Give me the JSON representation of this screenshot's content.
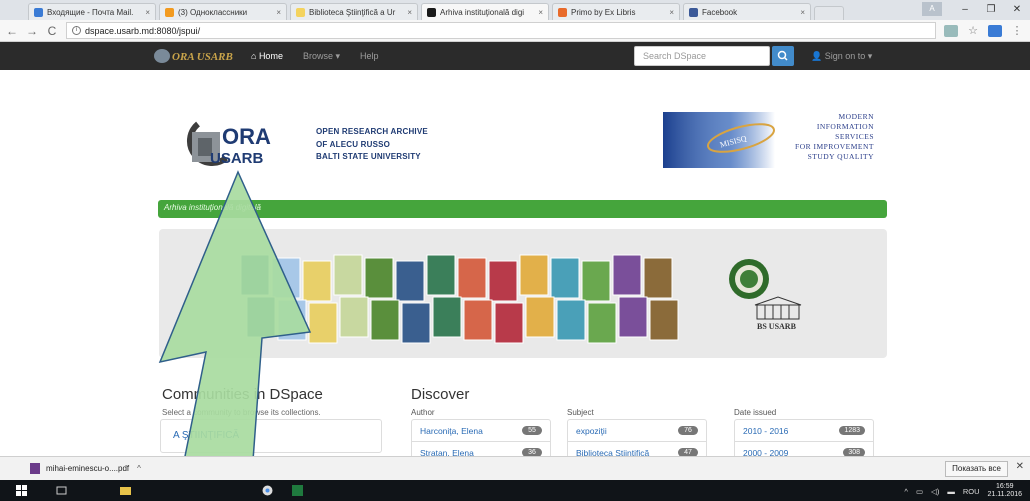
{
  "browser": {
    "tabs": [
      {
        "title": "Входящие - Почта Mail.",
        "color": "#3a7bd5",
        "active": false
      },
      {
        "title": "(3) Одноклассники",
        "color": "#f29a1f",
        "active": false
      },
      {
        "title": "Biblioteca Ştiinţifică a Ur",
        "color": "#f4d35e",
        "active": false
      },
      {
        "title": "Arhiva instituţională digi",
        "color": "#1a1a1a",
        "active": true
      },
      {
        "title": "Primo by Ex Libris",
        "color": "#e86a2a",
        "active": false
      },
      {
        "title": "Facebook",
        "color": "#3b5998",
        "active": false
      }
    ],
    "tab_close": "×",
    "url": "dspace.usarb.md:8080/jspui/",
    "window_controls": {
      "user": "A",
      "minimize": "–",
      "maximize": "❐",
      "close": "✕"
    },
    "nav": {
      "back": "←",
      "forward": "→",
      "reload": "C",
      "info": "i"
    }
  },
  "navbar": {
    "brand": "ORA USARB",
    "home": "Home",
    "browse": "Browse ▾",
    "help": "Help",
    "search_placeholder": "Search DSpace",
    "sign_on": "Sign on to ▾"
  },
  "header": {
    "logo_lines": [
      "OPEN RESEARCH ARCHIVE",
      "OF ALECU RUSSO",
      "BALTI STATE UNIVERSITY"
    ],
    "logo_word_top": "ORA",
    "logo_word_bottom": "USARB",
    "mis_lines": [
      "MODERN",
      "INFORMATION",
      "SERVICES",
      "FOR IMPROVEMENT",
      "STUDY QUALITY"
    ],
    "mis_badge": "MISISQ"
  },
  "breadcrumb": "Arhiva instituţională digitală",
  "banner": {
    "right_label": "BS USARB"
  },
  "communities": {
    "title": "Communities in DSpace",
    "subtitle": "Select a community to browse its collections.",
    "first_item": "A ŞTIINŢIFICĂ"
  },
  "discover": {
    "title": "Discover",
    "facets": [
      {
        "heading": "Author",
        "rows": [
          {
            "label": "Harconiţa, Elena",
            "count": "55"
          },
          {
            "label": "Stratan, Elena",
            "count": "36"
          }
        ]
      },
      {
        "heading": "Subject",
        "rows": [
          {
            "label": "expoziţii",
            "count": "76"
          },
          {
            "label": "Biblioteca Ştiinţifică",
            "count": "47"
          }
        ]
      },
      {
        "heading": "Date issued",
        "rows": [
          {
            "label": "2010 - 2016",
            "count": "1283"
          },
          {
            "label": "2000 - 2009",
            "count": "308"
          }
        ]
      }
    ]
  },
  "downloads": {
    "file": "mihai-eminescu-o....pdf",
    "chevron": "^",
    "show_all": "Показать все",
    "close": "✕"
  },
  "taskbar": {
    "lang": "ROU",
    "time": "16:59",
    "date": "21.11.2016"
  },
  "colors": {
    "navbar": "#2b2b2b",
    "breadcrumb": "#45a53c",
    "arrow": "#a8dba0",
    "link": "#2a6bb5"
  }
}
